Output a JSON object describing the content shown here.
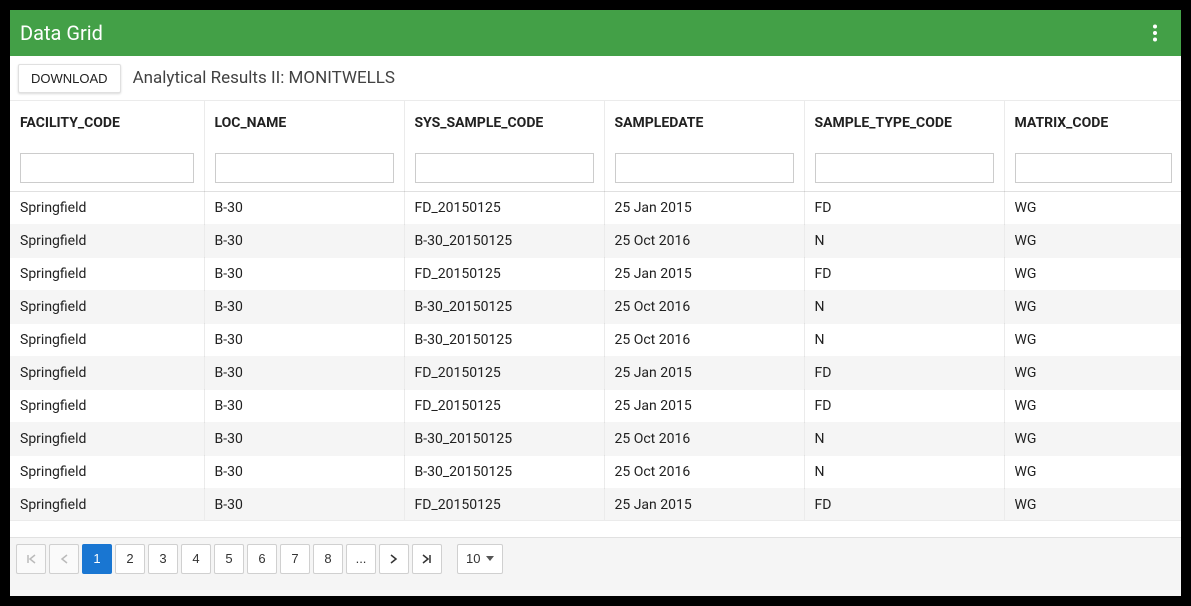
{
  "header": {
    "title": "Data Grid"
  },
  "toolbar": {
    "download_label": "DOWNLOAD",
    "subtitle": "Analytical Results II: MONITWELLS"
  },
  "columns": [
    {
      "key": "facility_code",
      "label": "FACILITY_CODE"
    },
    {
      "key": "loc_name",
      "label": "LOC_NAME"
    },
    {
      "key": "sys_sample_code",
      "label": "SYS_SAMPLE_CODE"
    },
    {
      "key": "sampledate",
      "label": "SAMPLEDATE"
    },
    {
      "key": "sample_type_code",
      "label": "SAMPLE_TYPE_CODE"
    },
    {
      "key": "matrix_code",
      "label": "MATRIX_CODE"
    }
  ],
  "rows": [
    {
      "facility_code": "Springfield",
      "loc_name": "B-30",
      "sys_sample_code": "FD_20150125",
      "sampledate": "25 Jan 2015",
      "sample_type_code": "FD",
      "matrix_code": "WG"
    },
    {
      "facility_code": "Springfield",
      "loc_name": "B-30",
      "sys_sample_code": "B-30_20150125",
      "sampledate": "25 Oct 2016",
      "sample_type_code": "N",
      "matrix_code": "WG"
    },
    {
      "facility_code": "Springfield",
      "loc_name": "B-30",
      "sys_sample_code": "FD_20150125",
      "sampledate": "25 Jan 2015",
      "sample_type_code": "FD",
      "matrix_code": "WG"
    },
    {
      "facility_code": "Springfield",
      "loc_name": "B-30",
      "sys_sample_code": "B-30_20150125",
      "sampledate": "25 Oct 2016",
      "sample_type_code": "N",
      "matrix_code": "WG"
    },
    {
      "facility_code": "Springfield",
      "loc_name": "B-30",
      "sys_sample_code": "B-30_20150125",
      "sampledate": "25 Oct 2016",
      "sample_type_code": "N",
      "matrix_code": "WG"
    },
    {
      "facility_code": "Springfield",
      "loc_name": "B-30",
      "sys_sample_code": "FD_20150125",
      "sampledate": "25 Jan 2015",
      "sample_type_code": "FD",
      "matrix_code": "WG"
    },
    {
      "facility_code": "Springfield",
      "loc_name": "B-30",
      "sys_sample_code": "FD_20150125",
      "sampledate": "25 Jan 2015",
      "sample_type_code": "FD",
      "matrix_code": "WG"
    },
    {
      "facility_code": "Springfield",
      "loc_name": "B-30",
      "sys_sample_code": "B-30_20150125",
      "sampledate": "25 Oct 2016",
      "sample_type_code": "N",
      "matrix_code": "WG"
    },
    {
      "facility_code": "Springfield",
      "loc_name": "B-30",
      "sys_sample_code": "B-30_20150125",
      "sampledate": "25 Oct 2016",
      "sample_type_code": "N",
      "matrix_code": "WG"
    },
    {
      "facility_code": "Springfield",
      "loc_name": "B-30",
      "sys_sample_code": "FD_20150125",
      "sampledate": "25 Jan 2015",
      "sample_type_code": "FD",
      "matrix_code": "WG"
    }
  ],
  "pager": {
    "pages": [
      "1",
      "2",
      "3",
      "4",
      "5",
      "6",
      "7",
      "8",
      "..."
    ],
    "active_index": 0,
    "page_size": "10"
  }
}
